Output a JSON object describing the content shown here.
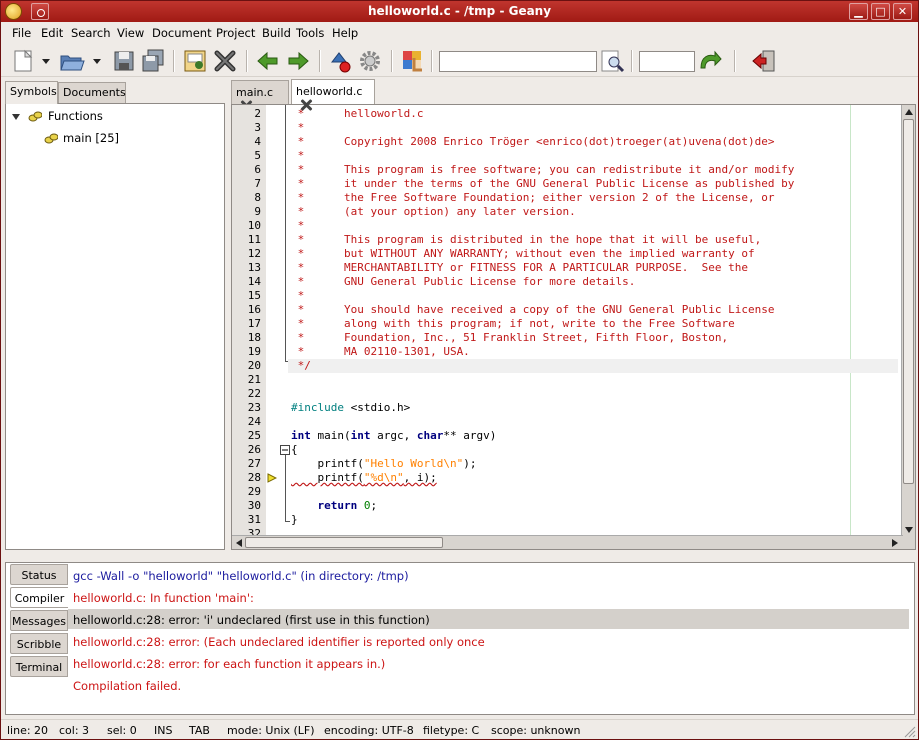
{
  "window": {
    "title": "helloworld.c - /tmp - Geany",
    "buttons": {
      "minimize": "▁",
      "maximize": "□",
      "close": "✕"
    }
  },
  "menubar": {
    "items": [
      {
        "label": "File"
      },
      {
        "label": "Edit"
      },
      {
        "label": "Search"
      },
      {
        "label": "View"
      },
      {
        "label": "Document"
      },
      {
        "label": "Project"
      },
      {
        "label": "Build"
      },
      {
        "label": "Tools"
      },
      {
        "label": "Help"
      }
    ]
  },
  "toolbar": {
    "search_value": "",
    "goto_line_value": ""
  },
  "sidebar": {
    "tabs": [
      {
        "label": "Symbols"
      },
      {
        "label": "Documents"
      }
    ],
    "active_tab": "Symbols",
    "tree": {
      "group_label": "Functions",
      "items": [
        {
          "label": "main [25]"
        }
      ]
    }
  },
  "editor": {
    "tabs": [
      {
        "label": "main.c"
      },
      {
        "label": "helloworld.c"
      }
    ],
    "active_tab": "helloworld.c",
    "line_numbers": [
      "2",
      "3",
      "4",
      "5",
      "6",
      "7",
      "8",
      "9",
      "10",
      "11",
      "12",
      "13",
      "14",
      "15",
      "16",
      "17",
      "18",
      "19",
      "20",
      "21",
      "22",
      "23",
      "24",
      "25",
      "26",
      "27",
      "28",
      "29",
      "30",
      "31",
      "32"
    ],
    "lines": {
      "l2": " *      helloworld.c",
      "l3": " *",
      "l4": " *      Copyright 2008 Enrico Tröger <enrico(dot)troeger(at)uvena(dot)de>",
      "l5": " *",
      "l6": " *      This program is free software; you can redistribute it and/or modify",
      "l7": " *      it under the terms of the GNU General Public License as published by",
      "l8": " *      the Free Software Foundation; either version 2 of the License, or",
      "l9": " *      (at your option) any later version.",
      "l10": " *",
      "l11": " *      This program is distributed in the hope that it will be useful,",
      "l12": " *      but WITHOUT ANY WARRANTY; without even the implied warranty of",
      "l13": " *      MERCHANTABILITY or FITNESS FOR A PARTICULAR PURPOSE.  See the",
      "l14": " *      GNU General Public License for more details.",
      "l15": " *",
      "l16": " *      You should have received a copy of the GNU General Public License",
      "l17": " *      along with this program; if not, write to the Free Software",
      "l18": " *      Foundation, Inc., 51 Franklin Street, Fifth Floor, Boston,",
      "l19": " *      MA 02110-1301, USA.",
      "l20": " */",
      "l23_pp": "#include",
      "l23_rest": " <stdio.h>",
      "l25_kw1": "int",
      "l25_mid": " main(",
      "l25_kw2": "int",
      "l25_mid2": " argc, ",
      "l25_kw3": "char",
      "l25_end": "** argv)",
      "l26": "{",
      "l27_a": "    printf(",
      "l27_str": "\"Hello World\\n\"",
      "l27_b": ");",
      "l28_a": "    printf(",
      "l28_str": "\"%d\\n\"",
      "l28_b": ", i);",
      "l30_kw": "return",
      "l30_num": "0",
      "l30_end": ";",
      "l31": "}"
    }
  },
  "messages": {
    "tabs": [
      {
        "label": "Status"
      },
      {
        "label": "Compiler"
      },
      {
        "label": "Messages"
      },
      {
        "label": "Scribble"
      },
      {
        "label": "Terminal"
      }
    ],
    "active_tab": "Compiler",
    "items": [
      {
        "text": "gcc -Wall -o \"helloworld\" \"helloworld.c\" (in directory: /tmp)",
        "color": "#1a1a9e"
      },
      {
        "text": "helloworld.c: In function 'main':",
        "color": "#cc1414"
      },
      {
        "text": "helloworld.c:28: error: 'i' undeclared (first use in this function)",
        "color": "#000000"
      },
      {
        "text": "helloworld.c:28: error: (Each undeclared identifier is reported only once",
        "color": "#cc1414"
      },
      {
        "text": "helloworld.c:28: error: for each function it appears in.)",
        "color": "#cc1414"
      },
      {
        "text": "Compilation failed.",
        "color": "#cc1414"
      }
    ]
  },
  "statusbar": {
    "line": "line: 20",
    "col": "col: 3",
    "sel": "sel: 0",
    "ins": "INS",
    "tab": "TAB",
    "mode": "mode: Unix (LF)",
    "encoding": "encoding: UTF-8",
    "filetype": "filetype: C",
    "scope": "scope: unknown"
  }
}
